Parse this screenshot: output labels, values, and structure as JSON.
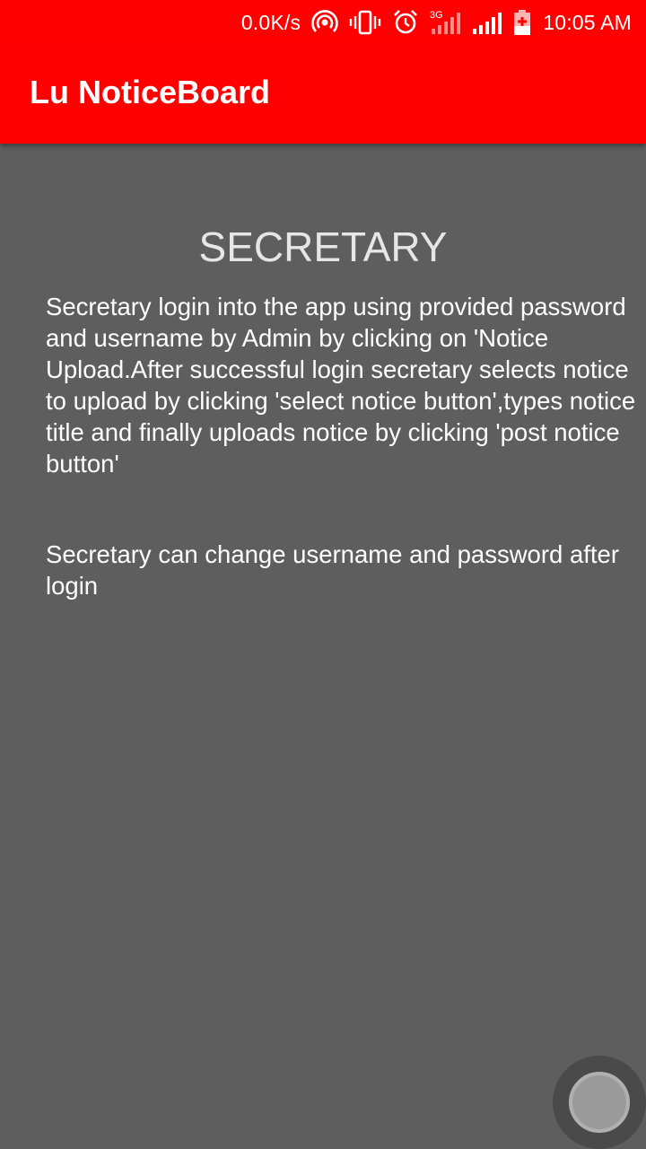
{
  "status_bar": {
    "net_speed": "0.0K/s",
    "network_type": "3G",
    "time": "10:05 AM",
    "icons": [
      "hotspot-icon",
      "vibrate-icon",
      "alarm-icon",
      "signal-3g-icon",
      "signal-icon",
      "battery-charging-icon"
    ]
  },
  "app_bar": {
    "title": "Lu NoticeBoard"
  },
  "main": {
    "heading": "SECRETARY",
    "paragraph_1": "Secretary login into the app using provided password and username by Admin by clicking on 'Notice Upload.After successful login secretary selects notice to upload by clicking 'select notice button',types notice title and finally uploads notice by clicking 'post notice button'",
    "paragraph_2": "Secretary can change username and password after login"
  },
  "colors": {
    "accent": "#ff0000",
    "background": "#5e5e5e",
    "heading_text": "#e6e6e6",
    "body_text": "#ffffff"
  }
}
